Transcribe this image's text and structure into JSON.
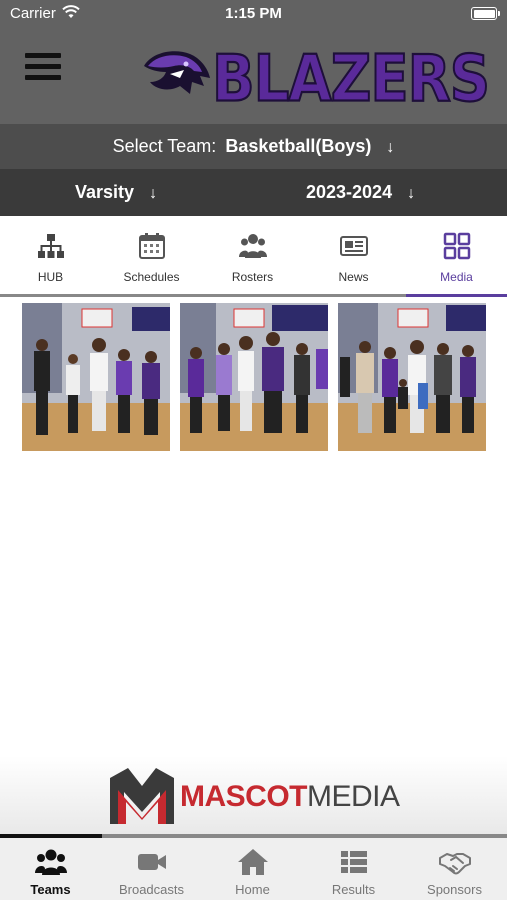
{
  "status_bar": {
    "carrier": "Carrier",
    "time": "1:15 PM"
  },
  "header": {
    "brand_text": "BLAZERS",
    "brand_color": "#5a2a9a"
  },
  "team_selector": {
    "label": "Select Team:",
    "value": "Basketball(Boys)"
  },
  "filters": {
    "level": "Varsity",
    "season": "2023-2024"
  },
  "tabs": [
    {
      "label": "HUB",
      "icon": "hierarchy-icon"
    },
    {
      "label": "Schedules",
      "icon": "calendar-icon"
    },
    {
      "label": "Rosters",
      "icon": "group-icon"
    },
    {
      "label": "News",
      "icon": "newspaper-icon"
    },
    {
      "label": "Media",
      "icon": "grid-icon",
      "active": true
    }
  ],
  "gallery": {
    "photo_count": 3
  },
  "sponsor_banner": {
    "word1": "MASCOT",
    "word2": "MEDIA"
  },
  "bottom_nav": [
    {
      "label": "Teams",
      "icon": "group-icon",
      "active": true
    },
    {
      "label": "Broadcasts",
      "icon": "video-camera-icon"
    },
    {
      "label": "Home",
      "icon": "home-icon"
    },
    {
      "label": "Results",
      "icon": "list-icon"
    },
    {
      "label": "Sponsors",
      "icon": "handshake-icon"
    }
  ],
  "colors": {
    "accent": "#5a3e9e",
    "header_bg": "#626262",
    "brand_red": "#c62a30"
  }
}
